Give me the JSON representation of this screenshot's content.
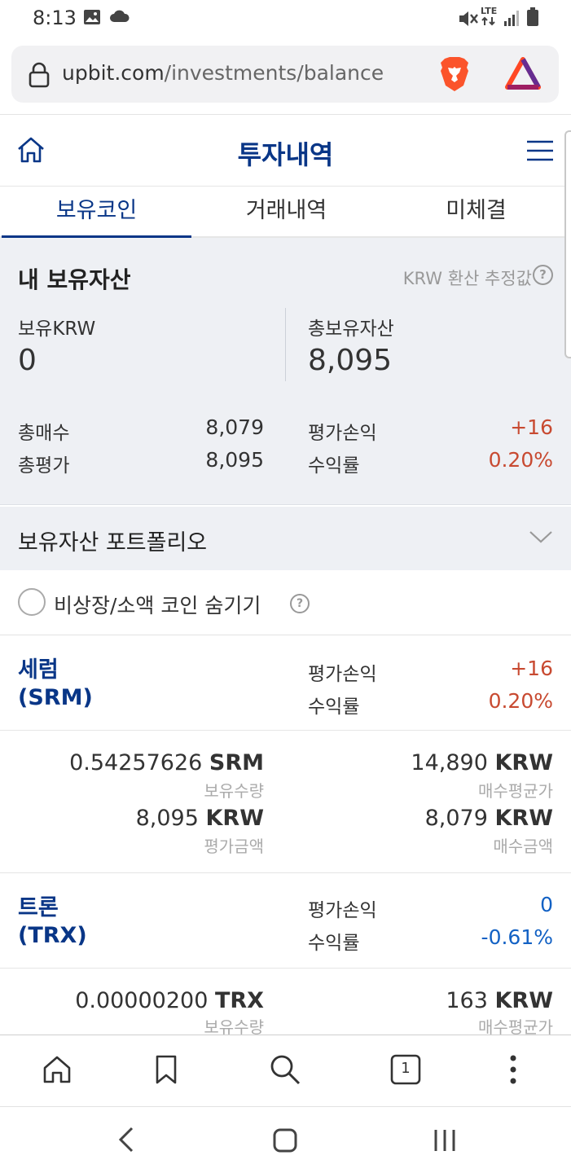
{
  "status_bar": {
    "time": "8:13",
    "icons": [
      "image-icon",
      "cloud-icon",
      "mute-icon",
      "lte-icon",
      "signal-icon",
      "battery-icon"
    ],
    "lte_label": "LTE"
  },
  "browser": {
    "url_domain": "upbit.com",
    "url_path": "/investments/balance",
    "icons": [
      "lock-icon",
      "brave-shield-icon",
      "brave-rewards-icon"
    ]
  },
  "header": {
    "title": "투자내역",
    "icons": [
      "home-icon",
      "menu-icon"
    ]
  },
  "tabs": [
    {
      "label": "보유코인",
      "active": true
    },
    {
      "label": "거래내역",
      "active": false
    },
    {
      "label": "미체결",
      "active": false
    }
  ],
  "summary": {
    "title": "내 보유자산",
    "note": "KRW 환산 추정값",
    "help": "?",
    "krw_label": "보유KRW",
    "krw_value": "0",
    "total_label": "총보유자산",
    "total_value": "8,095",
    "buy_label": "총매수",
    "buy_value": "8,079",
    "eval_label": "총평가",
    "eval_value": "8,095",
    "pnl_label": "평가손익",
    "pnl_value": "+16",
    "rate_label": "수익률",
    "rate_value": "0.20%"
  },
  "portfolio": {
    "label": "보유자산 포트폴리오"
  },
  "hide_option": {
    "label": "비상장/소액 코인 숨기기",
    "help": "?"
  },
  "coins": [
    {
      "name": "세럼",
      "symbol": "(SRM)",
      "pnl_label": "평가손익",
      "pnl_value": "+16",
      "rate_label": "수익률",
      "rate_value": "0.20%",
      "qty_value": "0.54257626",
      "qty_unit": "SRM",
      "qty_label": "보유수량",
      "avg_value": "14,890",
      "avg_unit": "KRW",
      "avg_label": "매수평균가",
      "eval_value": "8,095",
      "eval_unit": "KRW",
      "eval_label": "평가금액",
      "buy_value": "8,079",
      "buy_unit": "KRW",
      "buy_label": "매수금액"
    },
    {
      "name": "트론",
      "symbol": "(TRX)",
      "pnl_label": "평가손익",
      "pnl_value": "0",
      "rate_label": "수익률",
      "rate_value": "-0.61%",
      "qty_value": "0.00000200",
      "qty_unit": "TRX",
      "qty_label": "보유수량",
      "avg_value": "163",
      "avg_unit": "KRW",
      "avg_label": "매수평균가"
    }
  ],
  "bottom_nav": {
    "tab_count": "1",
    "icons": [
      "home-icon",
      "bookmark-icon",
      "search-icon",
      "tabs-icon",
      "more-icon"
    ]
  },
  "system_nav": {
    "icons": [
      "back-icon",
      "home-button-icon",
      "recents-icon"
    ]
  },
  "colors": {
    "brand": "#093687",
    "positive": "#c84a31",
    "negative": "#1261c4",
    "summary_bg": "#eef0f4"
  }
}
